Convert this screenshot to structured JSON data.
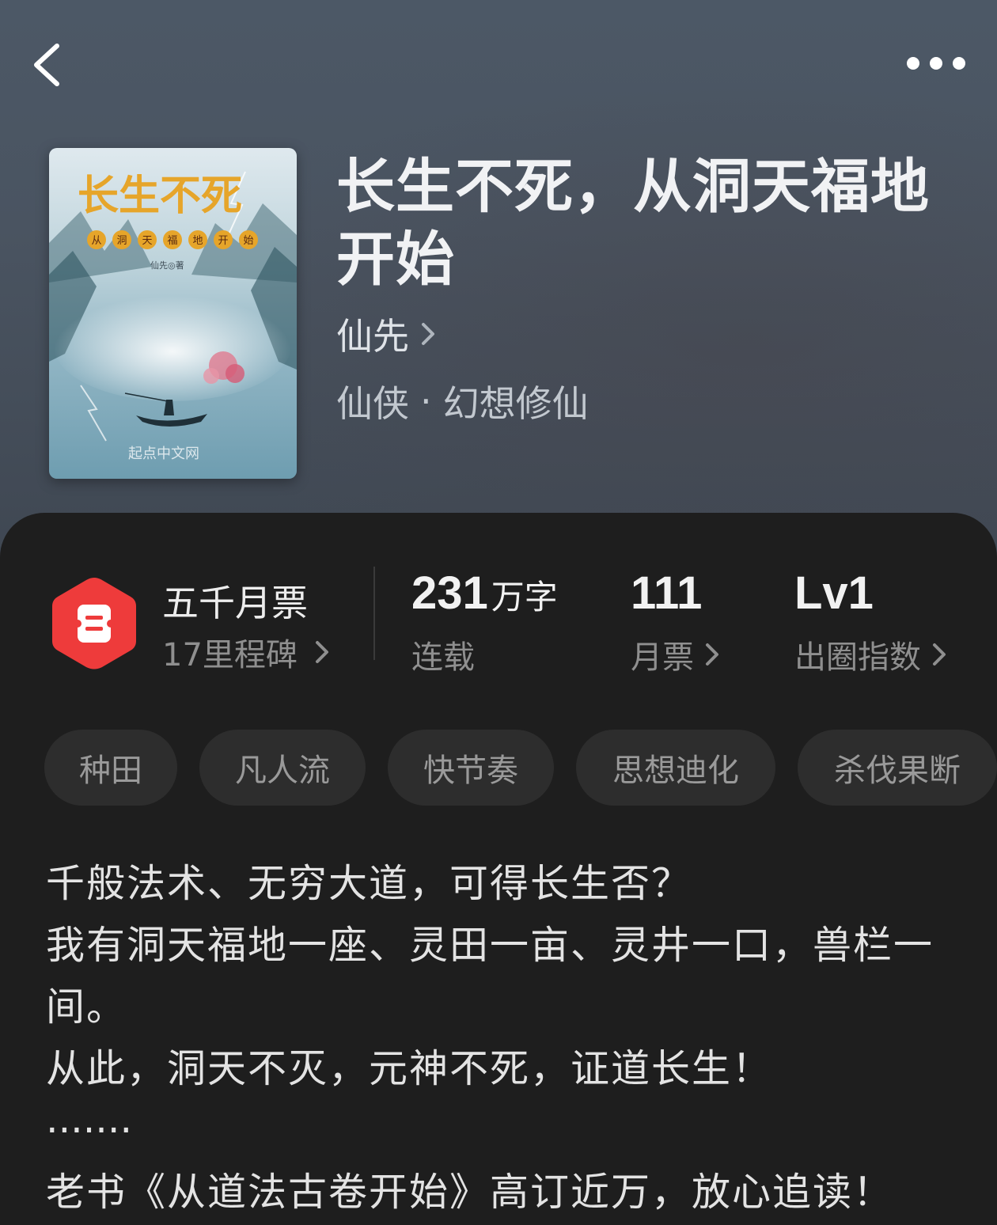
{
  "header": {
    "back_icon": "chevron-left-icon",
    "more_icon": "more-dots-icon"
  },
  "book": {
    "title": "长生不死，从洞天福地开始",
    "author": "仙先",
    "category": "仙侠",
    "separator": "·",
    "subcategory": "幻想修仙",
    "cover": {
      "title_text": "长生不死",
      "subtitle_chars": [
        "从",
        "洞",
        "天",
        "福",
        "地",
        "开",
        "始"
      ],
      "author_line": "仙先◎著",
      "publisher": "起点中文网"
    }
  },
  "monthly_ticket": {
    "icon": "ticket-badge-icon",
    "title": "五千月票",
    "subtitle": "17里程碑"
  },
  "stats": {
    "word_count": "231",
    "word_unit": "万字",
    "status": "连载",
    "tickets": "111",
    "tickets_label": "月票",
    "level": "Lv1",
    "level_label": "出圈指数"
  },
  "tags": [
    "种田",
    "凡人流",
    "快节奏",
    "思想迪化",
    "杀伐果断"
  ],
  "description": [
    "千般法术、无穷大道，可得长生否？",
    "我有洞天福地一座、灵田一亩、灵井一口，兽栏一间。",
    "从此，洞天不灭，元神不死，证道长生！",
    "·······",
    "老书《从道法古卷开始》高订近万，放心追读！"
  ],
  "colors": {
    "hero_bg": "#4b5562",
    "sheet_bg": "#1e1e1e",
    "tag_bg": "#2d2d2d",
    "badge_red": "#ee3b3b",
    "cover_gold": "#e6a52a"
  }
}
